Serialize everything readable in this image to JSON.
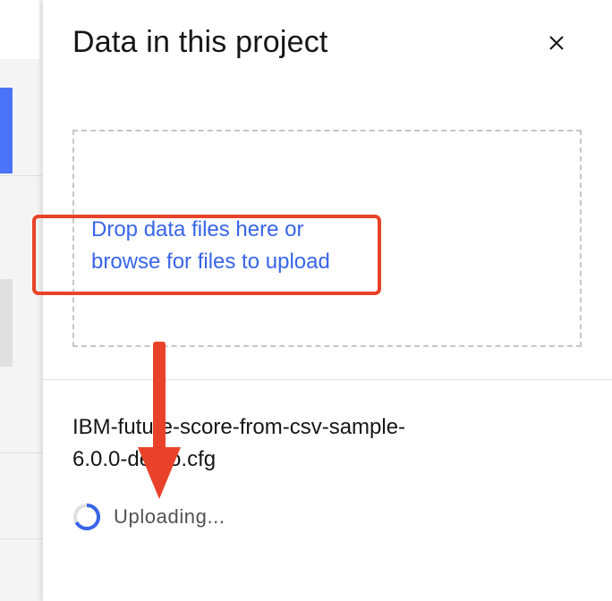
{
  "panel": {
    "title": "Data in this project",
    "close_icon": "close-icon"
  },
  "dropzone": {
    "text_line1": "Drop data files here or",
    "text_line2": "browse for files to upload"
  },
  "upload": {
    "file_name_line1": "IBM-future-score-from-csv-sample-",
    "file_name_line2": "6.0.0-demo.cfg",
    "status": "Uploading...",
    "spinner_icon": "loading-spinner-icon"
  },
  "annotations": {
    "highlight_color": "#e8432a",
    "arrow_color": "#e8432a"
  },
  "colors": {
    "link": "#3865e8",
    "accent": "#4a73f7"
  }
}
